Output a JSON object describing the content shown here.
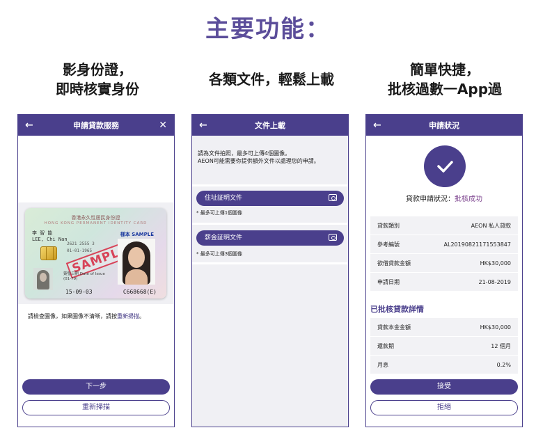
{
  "main_title": "主要功能：",
  "captions": {
    "c1_line1": "影身份證，",
    "c1_line2": "即時核實身份",
    "c2_line1": "各類文件，輕鬆上載",
    "c3_line1": "簡單快捷，",
    "c3_line2": "批核過數一App過"
  },
  "phone1": {
    "title": "申請貸款服務",
    "back_icon": "←",
    "close_icon": "✕",
    "card_header": "香港永久性居民身份證",
    "card_header_en": "HONG KONG PERMANENT IDENTITY CARD",
    "card_name_zh": "李 智 能",
    "card_name_en": "LEE, Chi Nan",
    "card_sample_label": "樣本 SAMPLE",
    "card_code": "2621 2555 3",
    "card_dob": "01-01-1965",
    "card_stamp": "SAMPLE",
    "card_issue_label": "簽發日期 Date of Issue",
    "card_issue_short": "(01-79)",
    "card_date": "15-09-03",
    "card_number": "C668668(E)",
    "note_prefix": "請檢查圖像，如果圖像不清晰，請按",
    "note_link": "重新掃描",
    "note_suffix": "。",
    "next_button": "下一步",
    "rescan_button": "重新掃描"
  },
  "phone2": {
    "title": "文件上載",
    "back_icon": "←",
    "intro_line1": "請為文件拍照，最多可上傳4個圖像。",
    "intro_line2": "AEON可能需要你提供額外文件以處理您的申請。",
    "address_label": "住址証明文件",
    "address_note": "* 最多可上傳1個圖像",
    "income_label": "薪金証明文件",
    "income_note": "* 最多可上傳3個圖像"
  },
  "phone3": {
    "title": "申請狀況",
    "back_icon": "←",
    "status_prefix": "貸款申請狀況：",
    "status_value": "批核成功",
    "info_rows": [
      {
        "label": "貸款類別",
        "value": "AEON 私人貸款"
      },
      {
        "label": "參考編號",
        "value": "AL20190821171553847"
      },
      {
        "label": "欲借貸款金額",
        "value": "HK$30,000"
      },
      {
        "label": "申請日期",
        "value": "21-08-2019"
      }
    ],
    "approved_title": "已批核貸款詳情",
    "approved_rows": [
      {
        "label": "貸款本金金額",
        "value": "HK$30,000"
      },
      {
        "label": "還款期",
        "value": "12 個月"
      },
      {
        "label": "月息",
        "value": "0.2%"
      }
    ],
    "accept_button": "接受",
    "reject_button": "拒絕"
  },
  "colors": {
    "brand": "#4a3f8c",
    "title": "#5b4d9a",
    "success": "#7a3f8c",
    "panel": "#f0f0f4"
  }
}
